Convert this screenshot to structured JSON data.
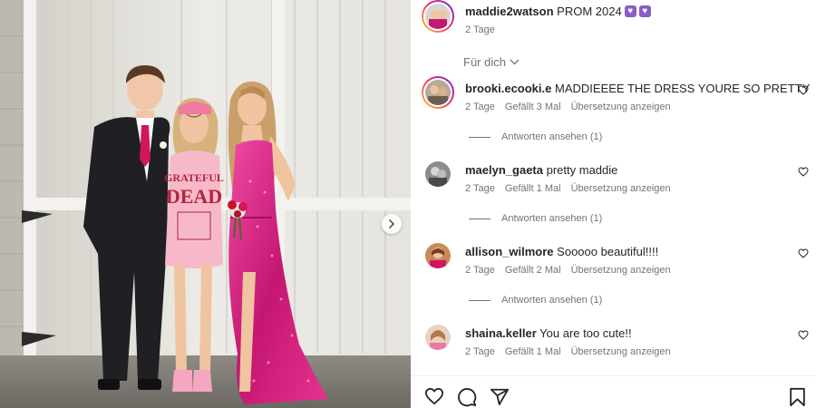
{
  "post": {
    "username": "maddie2watson",
    "caption": "PROM 2024",
    "age": "2 Tage"
  },
  "filter_label": "Für dich",
  "shirt_text": {
    "line1": "GRATEFUL",
    "line2": "DEAD"
  },
  "comments": [
    {
      "username": "brooki.ecooki.e",
      "text": "MADDIEEEE THE DRESS YOURE SO PRETTY",
      "age": "2 Tage",
      "likes": "Gefällt 3 Mal",
      "translate": "Übersetzung anzeigen",
      "replies": "Antworten ansehen (1)"
    },
    {
      "username": "maelyn_gaeta",
      "text": "pretty maddie",
      "age": "2 Tage",
      "likes": "Gefällt 1 Mal",
      "translate": "Übersetzung anzeigen",
      "replies": "Antworten ansehen (1)"
    },
    {
      "username": "allison_wilmore",
      "text": "Sooooo beautiful!!!!",
      "age": "2 Tage",
      "likes": "Gefällt 2 Mal",
      "translate": "Übersetzung anzeigen",
      "replies": "Antworten ansehen (1)"
    },
    {
      "username": "shaina.keller",
      "text": "You are too cute!!",
      "age": "2 Tage",
      "likes": "Gefällt 1 Mal",
      "translate": "Übersetzung anzeigen"
    }
  ],
  "icons": [
    "heart-icon",
    "comment-icon",
    "share-icon",
    "bookmark-icon",
    "chevron-down-icon",
    "chevron-right-icon",
    "purple-heart-emoji"
  ],
  "colors": {
    "text": "#262626",
    "secondary": "#737373",
    "dress": "#d0207a",
    "cap": "#f07aa0",
    "emoji": "#8a5cc7"
  }
}
